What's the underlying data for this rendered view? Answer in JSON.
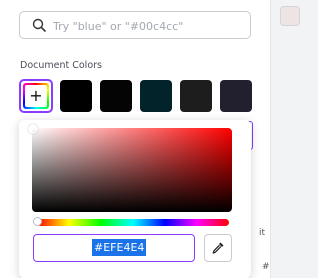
{
  "search": {
    "placeholder": "Try \"blue\" or \"#00c4cc\"",
    "icon": "search-icon"
  },
  "document_colors": {
    "title": "Document Colors",
    "add_label": "+",
    "swatches": [
      "#000000",
      "#040404",
      "#022329",
      "#1d1d1d",
      "#22202e"
    ]
  },
  "picker": {
    "hex_value": "#EFE4E4",
    "eyedropper_icon": "eyedropper-icon"
  },
  "right_panel": {
    "current_color": "#EFE4E4"
  },
  "peek": {
    "a": "it",
    "b": "#"
  },
  "accent": "#8b3dff"
}
